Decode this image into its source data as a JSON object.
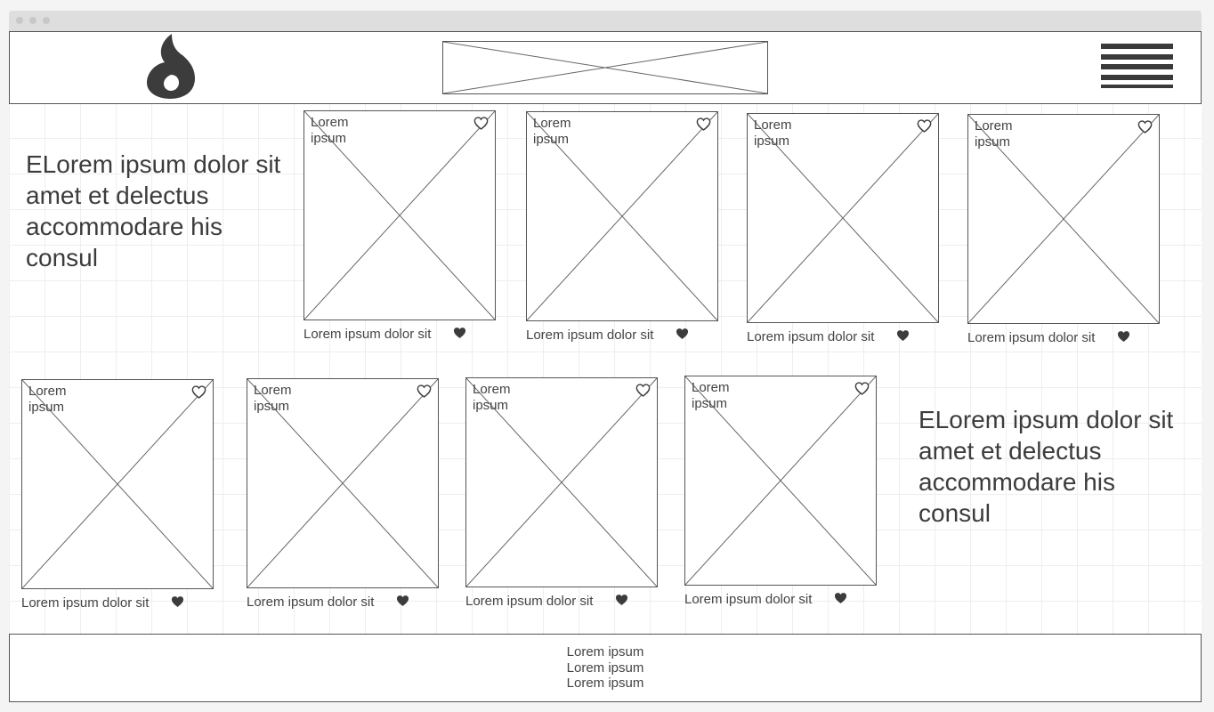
{
  "header": {
    "logo_icon": "flame-icon",
    "banner_icon": "image-placeholder",
    "menu_icon": "hamburger-menu-icon"
  },
  "intro": {
    "top_text": "ELorem ipsum dolor sit amet et delectus accommodare his consul",
    "bottom_text": "ELorem ipsum dolor sit amet et delectus accommodare his consul"
  },
  "cards_row1": [
    {
      "label": "Lorem ipsum",
      "caption": "Lorem ipsum dolor sit"
    },
    {
      "label": "Lorem ipsum",
      "caption": "Lorem ipsum dolor sit"
    },
    {
      "label": "Lorem ipsum",
      "caption": "Lorem ipsum dolor sit"
    },
    {
      "label": "Lorem ipsum",
      "caption": "Lorem ipsum dolor sit"
    }
  ],
  "cards_row2": [
    {
      "label": "Lorem ipsum",
      "caption": "Lorem ipsum dolor sit"
    },
    {
      "label": "Lorem ipsum",
      "caption": "Lorem ipsum dolor sit"
    },
    {
      "label": "Lorem ipsum",
      "caption": "Lorem ipsum dolor sit"
    },
    {
      "label": "Lorem ipsum",
      "caption": "Lorem ipsum dolor sit"
    }
  ],
  "icons": {
    "favorite_outline": "heart-outline-icon",
    "favorite_filled": "heart-filled-icon"
  },
  "footer": {
    "links": [
      "Lorem ipsum",
      "Lorem ipsum",
      "Lorem ipsum"
    ]
  },
  "colors": {
    "ink": "#3c3c3c",
    "border": "#555555",
    "grid": "#eeeeee"
  }
}
